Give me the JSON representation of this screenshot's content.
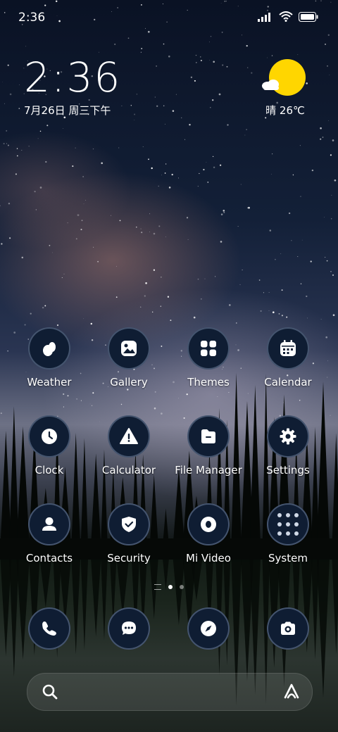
{
  "status_bar": {
    "time": "2:36",
    "icons": [
      "signal-icon",
      "wifi-icon",
      "battery-icon"
    ]
  },
  "clock_widget": {
    "time": "2:36",
    "date": "7月26日 周三下午"
  },
  "weather_widget": {
    "condition_icon": "sun-cloud-icon",
    "text": "晴 26℃"
  },
  "apps": [
    {
      "label": "Weather",
      "icon": "weather-icon"
    },
    {
      "label": "Gallery",
      "icon": "gallery-icon"
    },
    {
      "label": "Themes",
      "icon": "themes-icon"
    },
    {
      "label": "Calendar",
      "icon": "calendar-icon"
    },
    {
      "label": "Clock",
      "icon": "clock-icon"
    },
    {
      "label": "Calculator",
      "icon": "calculator-icon"
    },
    {
      "label": "File Manager",
      "icon": "file-manager-icon"
    },
    {
      "label": "Settings",
      "icon": "settings-icon"
    },
    {
      "label": "Contacts",
      "icon": "contacts-icon"
    },
    {
      "label": "Security",
      "icon": "security-icon"
    },
    {
      "label": "Mi Video",
      "icon": "mi-video-icon"
    },
    {
      "label": "System",
      "icon": "system-folder-icon"
    }
  ],
  "pager": {
    "pages": 2,
    "active_page": 1
  },
  "dock": [
    {
      "icon": "phone-icon"
    },
    {
      "icon": "messages-icon"
    },
    {
      "icon": "browser-icon"
    },
    {
      "icon": "camera-icon"
    }
  ],
  "search_bar": {
    "search_icon": "search-icon",
    "assistant_icon": "assistant-icon"
  },
  "colors": {
    "icon_background": "#0f1d33",
    "sun": "#ffd600"
  }
}
